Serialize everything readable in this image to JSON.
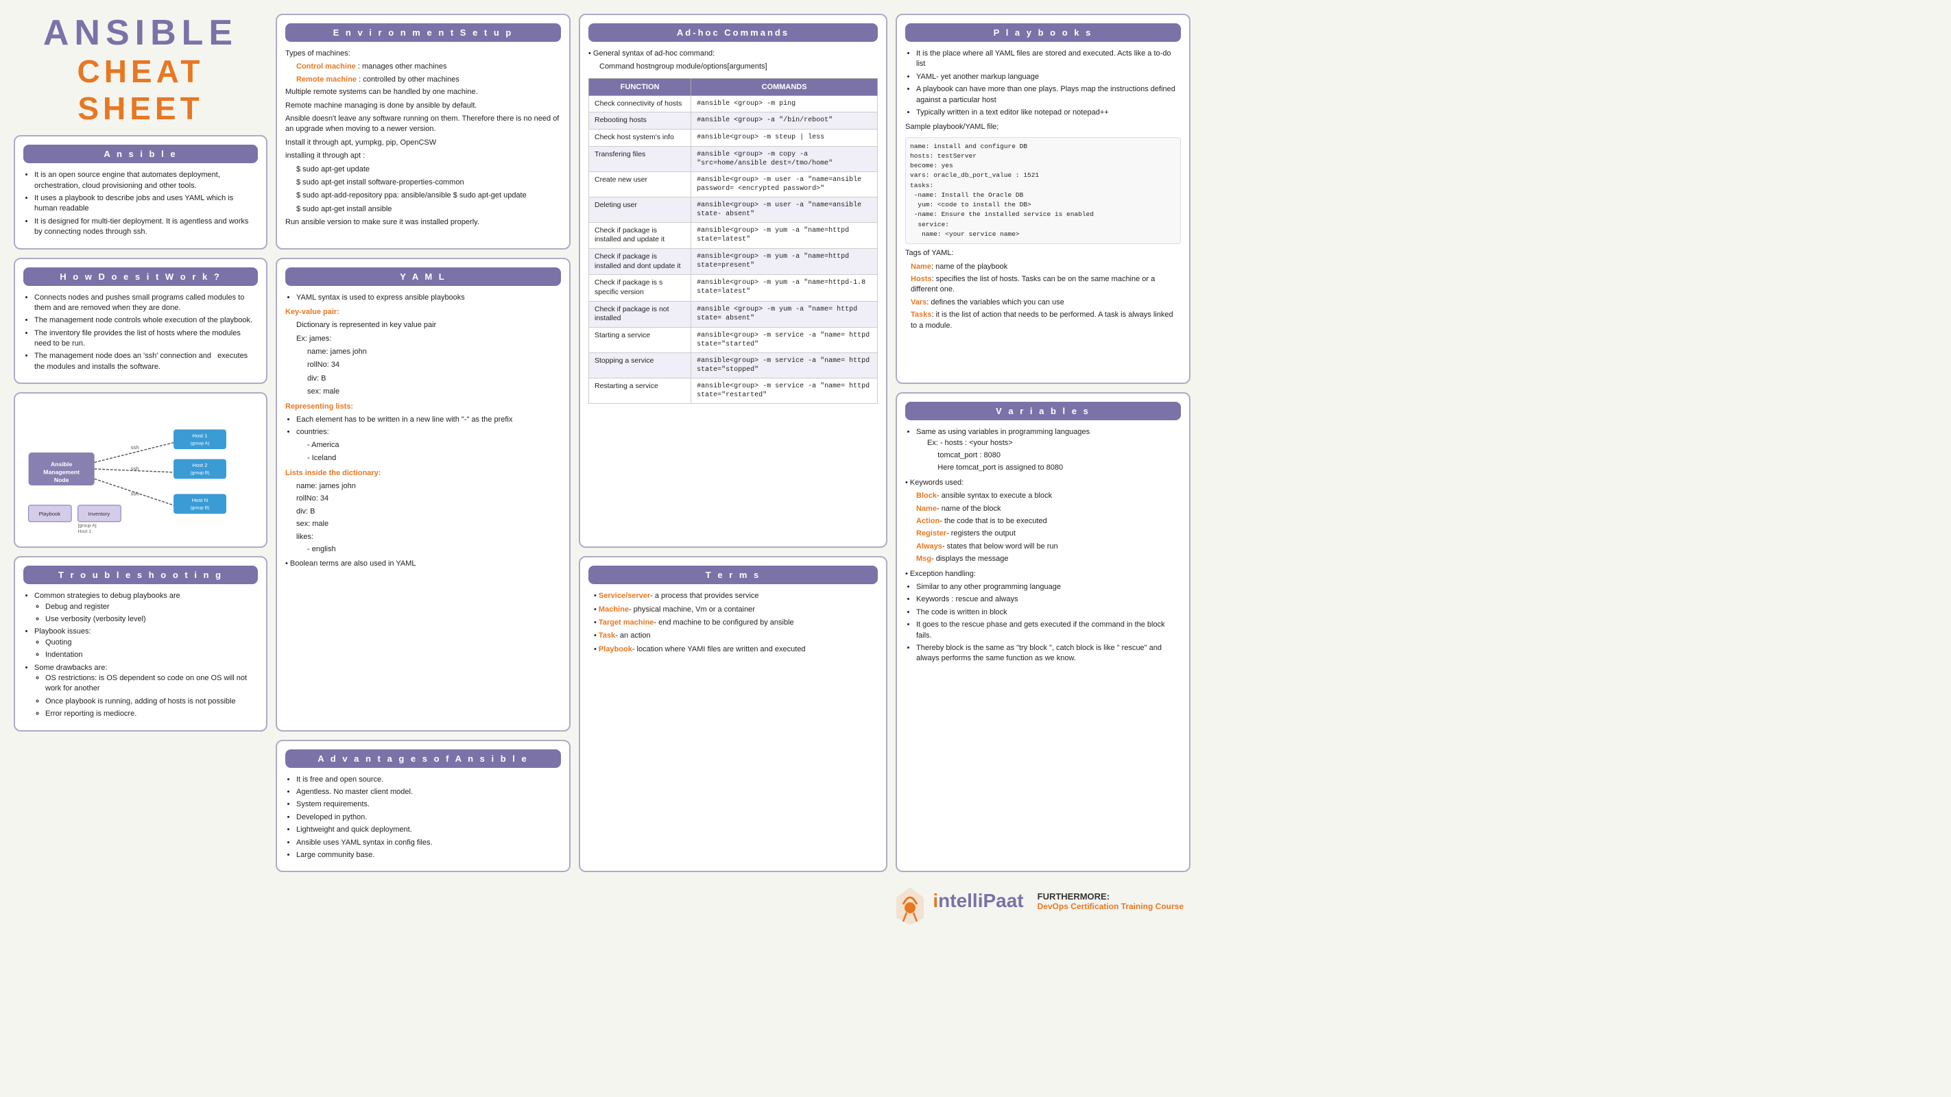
{
  "title": {
    "main": "ANSIBLE",
    "sub": "CHEAT SHEET"
  },
  "ansible_section": {
    "header": "A n s i b l e",
    "points": [
      "It is an open source engine that automates deployment, orchestration, cloud provisioning and other tools.",
      "It uses a playbook to describe jobs and uses YAML which is human readable",
      "It is designed for multi-tier deployment. It is agentless and works by connecting nodes through ssh."
    ]
  },
  "how_section": {
    "header": "H o w  D o e s  i t  W o r k ?",
    "points": [
      "Connects nodes and pushes small programs called modules to them and are removed when they are done.",
      "The management node controls whole execution of the playbook.",
      "The inventory file provides the list of hosts where the modules need to be run.",
      "The management node does an 'ssh' connection and executes the modules and installs the software."
    ]
  },
  "trouble_section": {
    "header": "T r o u b l e s h o o t i n g",
    "points": [
      {
        "text": "Common strategies to debug playbooks are",
        "sub": [
          "Debug and register",
          "Use verbosity (verbosity level)"
        ]
      },
      {
        "text": "Playbook issues:",
        "sub": [
          "Quoting",
          "Indentation"
        ]
      },
      {
        "text": "Some drawbacks are:",
        "sub": [
          "OS restrictions: is OS dependent so code on one OS will not work for another",
          "Once playbook is running, adding of hosts is not possible",
          "Error reporting is mediocre."
        ]
      }
    ]
  },
  "env_section": {
    "header": "E n v i r o n m e n t  S e t u p",
    "types_label": "Types of machines:",
    "machine_types": [
      {
        "label": "Control machine",
        "desc": ": manages other machines"
      },
      {
        "label": "Remote machine",
        "desc": ": controlled by other machines"
      }
    ],
    "points": [
      "Multiple remote systems can be handled by one machine.",
      "Remote machine managing is done by ansible by default.",
      "Ansible doesn't leave any software running on them. Therefore there is no need of an upgrade when moving to a newer version.",
      "Install it through apt, yumpkg, pip, OpenCSW",
      "installing it through apt :"
    ],
    "apt_commands": [
      "$ sudo apt-get update",
      "$ sudo apt-get install software-properties-common",
      "$ sudo apt-add-repository ppa: ansible/ansible $ sudo apt-get update",
      "$ sudo apt-get install ansible"
    ],
    "last_point": "Run ansible version to make sure it was installed properly."
  },
  "yaml_section": {
    "header": "Y A M L",
    "points": [
      "YAML syntax is used to express ansible playbooks"
    ],
    "key_value_label": "Key-value pair:",
    "key_value_desc": "Dictionary is represented in key value pair",
    "example": "Ex: james:",
    "kv_items": [
      "name: james john",
      "rollNo: 34",
      "div: B",
      "sex: male"
    ],
    "repr_list_label": "Representing lists:",
    "repr_list_points": [
      "Each element has to be written in a new line with \"-\" as the prefix",
      "countries:"
    ],
    "countries": [
      "- America",
      "- Iceland"
    ],
    "list_dict_label": "Lists inside the dictionary:",
    "list_dict_items": [
      "name: james john",
      "rollNo: 34",
      "div: B",
      "sex: male",
      "likes:",
      " - english"
    ],
    "boolean_note": "Boolean terms are also used in YAML"
  },
  "adv_section": {
    "header": "A d v a n t a g e s  o f  A n s i b l e",
    "points": [
      "It is free and open source.",
      "Agentless. No master client model.",
      "System requirements.",
      "Developed in python.",
      "Lightweight and quick deployment.",
      "Ansible uses YAML syntax in config files.",
      "Large community base."
    ]
  },
  "adhoc_section": {
    "header": "Ad-hoc Commands",
    "general_syntax": "General syntax of ad-hoc command:",
    "syntax_example": "Command hostngroup module/options[arguments]",
    "col_function": "FUNCTION",
    "col_commands": "COMMANDS",
    "rows": [
      {
        "function": "Check connectivity of hosts",
        "command": "#ansible <group> -m ping"
      },
      {
        "function": "Rebooting hosts",
        "command": "#ansible <group> -a \"/bin/reboot\""
      },
      {
        "function": "Check host system's info",
        "command": "#ansible<group> -m steup | less"
      },
      {
        "function": "Transfering files",
        "command": "#ansible <group> -m copy -a \"src=home/ansible dest=/tmo/home\""
      },
      {
        "function": "Create new user",
        "command": "#ansible<group> -m user -a \"name=ansible password= <encrypted password>\""
      },
      {
        "function": "Deleting user",
        "command": "#ansible<group> -m user -a \"name=ansible state- absent\""
      },
      {
        "function": "Check if package is installed and update it",
        "command": "#ansible<group> -m yum -a \"name=httpd state=latest\""
      },
      {
        "function": "Check if package is installed and dont update it",
        "command": "#ansible<group> -m yum -a \"name=httpd state=present\""
      },
      {
        "function": "Check if package is s specific version",
        "command": "#ansible<group> -m yum -a \"name=httpd-1.8 state=latest\""
      },
      {
        "function": "Check if package is not installed",
        "command": "#ansible <group> -m yum -a \"name= httpd state= absent\""
      },
      {
        "function": "Starting a service",
        "command": "#ansible<group> -m service -a \"name= httpd state=\"started\""
      },
      {
        "function": "Stopping a service",
        "command": "#ansible<group> -m service -a \"name= httpd state=\"stopped\""
      },
      {
        "function": "Restarting a service",
        "command": "#ansible<group> -m service -a \"name= httpd state=\"restarted\""
      }
    ]
  },
  "terms_section": {
    "header": "T e r m s",
    "terms": [
      {
        "label": "Service/server",
        "color": "orange",
        "desc": " a process that provides service"
      },
      {
        "label": "Machine",
        "color": "orange",
        "desc": " physical machine, Vm or a container"
      },
      {
        "label": "Target machine",
        "color": "orange",
        "desc": " end machine to be configured by ansible"
      },
      {
        "label": "Task",
        "color": "orange",
        "desc": " an action"
      },
      {
        "label": "Playbook",
        "color": "orange",
        "desc": " location where YAMI files are written and executed"
      }
    ]
  },
  "playbooks_section": {
    "header": "P l a y b o o k s",
    "points": [
      "It is the place where all YAML files are stored and executed. Acts like a to-do list",
      "YAML- yet another markup language",
      "A playbook can have more than one plays. Plays map the instructions defined against a particular host",
      "Typically written in a text editor like notepad or notepad++"
    ],
    "sample_label": "Sample playbook/YAML file;",
    "sample_code": [
      "name: install and configure DB",
      "hosts: testServer",
      "become: yes",
      "vars: oracle_db_port_value : 1521",
      "tasks:",
      " -name: Install the Oracle DB",
      "  yum: <code to install the DB>",
      " -name: Ensure the installed service is enabled",
      "  service:",
      "   name: <your service name>"
    ],
    "tags_label": "Tags of YAML:",
    "tags": [
      {
        "label": "Name",
        "color": "orange",
        "desc": ": name of the playbook"
      },
      {
        "label": "Hosts",
        "color": "orange",
        "desc": ": specifies the list of hosts. Tasks can be on the same machine or a different one."
      },
      {
        "label": "Vars",
        "color": "orange",
        "desc": ": defines the variables which you can use"
      },
      {
        "label": "Tasks",
        "color": "orange",
        "desc": ": it is the list of action that needs to be performed. A task is always linked to a module."
      }
    ]
  },
  "variables_section": {
    "header": "V a r i a b l e s",
    "points": [
      "Same as using variables in programming languages"
    ],
    "example_label": "Ex:",
    "examples": [
      "hosts : <your hosts>",
      "tomcat_port : 8080",
      "Here tomcat_port is assigned to 8080"
    ],
    "keywords_label": "Keywords used:",
    "keywords": [
      {
        "label": "Block",
        "color": "orange",
        "desc": " ansible syntax to execute a block"
      },
      {
        "label": "Name",
        "color": "orange",
        "desc": " name of the block"
      },
      {
        "label": "Action",
        "color": "orange",
        "desc": " the code that is to be executed"
      },
      {
        "label": "Register",
        "color": "orange",
        "desc": " registers the output"
      },
      {
        "label": "Always",
        "color": "orange",
        "desc": " states that below word will be run"
      },
      {
        "label": "Msg",
        "color": "orange",
        "desc": " displays the message"
      }
    ],
    "exception_label": "Exception handling:",
    "exception_points": [
      "Similar to any other programming language",
      "Keywords : rescue and always",
      "The code is written in block",
      "It goes to the rescue phase and gets executed if the command in the block fails.",
      "Thereby block is the same as \"try block\", catch block is like \" rescue\" and always performs the same function as we know."
    ]
  },
  "logo": {
    "intellipaat": "IntelliPaat",
    "furthermore": "FURTHERMORE:",
    "devops": "DevOps Certification Training Course"
  }
}
